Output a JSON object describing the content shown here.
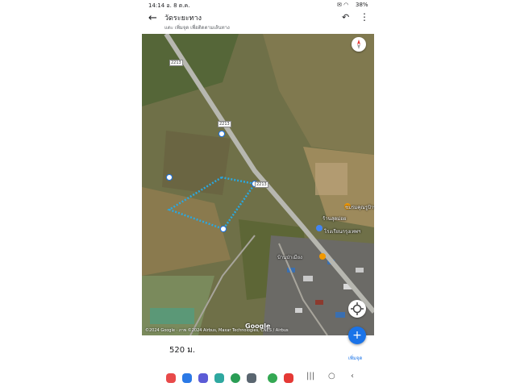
{
  "status_bar": {
    "time": "14:14",
    "date": "อ. 8 ต.ค.",
    "battery": "38%"
  },
  "header": {
    "back_icon": "arrow-left-icon",
    "title": "วัดระยะทาง",
    "subtitle": "แตะ เพิ่มจุด เพื่อติดตามเส้นทาง",
    "undo_icon": "undo-icon",
    "more_icon": "more-vert-icon"
  },
  "map": {
    "road_labels": [
      "2213",
      "2213",
      "2213"
    ],
    "pois": [
      "ชมรมคุณรูป้านชัยม",
      "ร้านสุดม่อย",
      "โรงเรียนกรุงเทพฯ",
      "บ้านป่าเมียง"
    ],
    "watermark": "Google",
    "copyright": "©2024 Google · ภาพ ©2024 Airbus, Maxar Technologies, CNES / Airbus",
    "compass_icon": "compass-icon",
    "locate_icon": "my-location-icon"
  },
  "measurement": {
    "distance": "520 ม.",
    "add_point_label": "เพิ่มจุด"
  },
  "fab": {
    "label": "+"
  },
  "nav_bar": {
    "apps": [
      "contacts-icon",
      "messages-icon",
      "calendar-icon",
      "gallery-icon",
      "chrome-icon",
      "apps-grid-icon",
      "maps-icon",
      "youtube-icon"
    ],
    "buttons": [
      "recent-apps-icon",
      "home-icon",
      "back-nav-icon"
    ]
  },
  "colors": {
    "accent": "#1a73e8",
    "path": "#2aa8e0"
  }
}
